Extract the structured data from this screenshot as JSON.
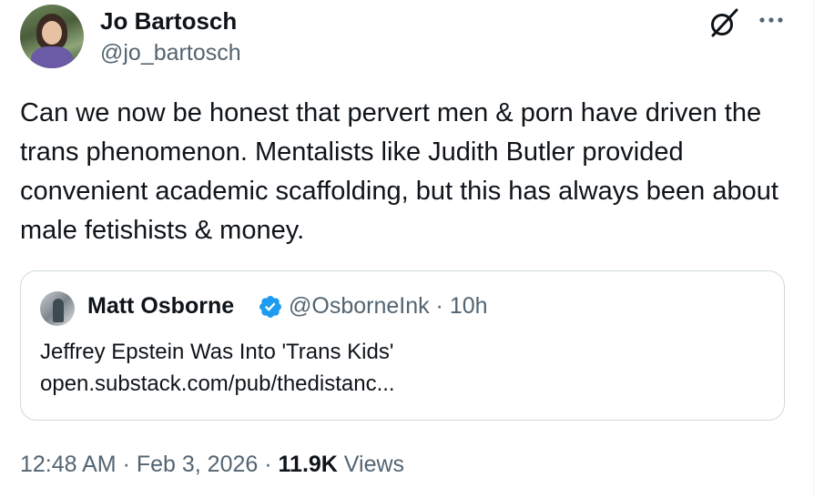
{
  "author": {
    "name": "Jo Bartosch",
    "handle": "@jo_bartosch",
    "avatar_icon": "profile-photo"
  },
  "tweet": {
    "text": "Can we now be honest that pervert men & porn have driven the trans phenomenon. Mentalists like Judith Butler provided convenient academic scaffolding, but this has always been about male fetishists & money."
  },
  "quoted_tweet": {
    "name": "Matt Osborne",
    "verified": true,
    "handle_time": "@OsborneInk · 10h",
    "title": "Jeffrey Epstein Was Into 'Trans Kids'",
    "link": "open.substack.com/pub/thedistanc..."
  },
  "meta": {
    "time": "12:48 AM",
    "sep1": " · ",
    "date": "Feb 3, 2026",
    "sep2": " · ",
    "views_count": "11.9K",
    "views_label": " Views"
  },
  "icons": {
    "grok": "grok-icon",
    "more": "more-icon",
    "verified": "verified-badge-icon"
  },
  "colors": {
    "text": "#0f1419",
    "secondary": "#536471",
    "border": "#cfd9de",
    "verified": "#1d9bf0"
  }
}
